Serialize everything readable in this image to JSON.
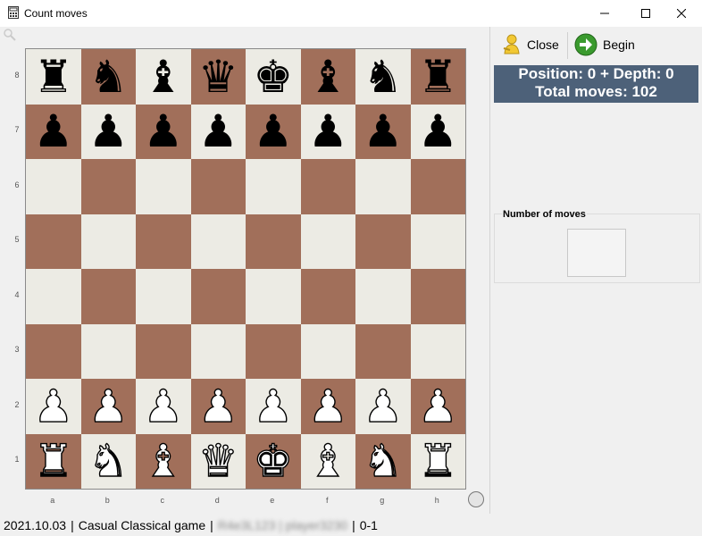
{
  "window": {
    "title": "Count moves",
    "icon": "calculator-icon",
    "controls": [
      "minimize-icon",
      "maximize-icon",
      "close-icon"
    ]
  },
  "toolbar": {
    "close_label": "Close",
    "close_icon": "person-icon",
    "begin_label": "Begin",
    "begin_icon": "arrow-right-icon"
  },
  "info": {
    "line1": "Position: 0 + Depth: 0",
    "line2": "Total moves: 102"
  },
  "moves_group": {
    "label": "Number of moves",
    "value": ""
  },
  "board": {
    "ranks": [
      "8",
      "7",
      "6",
      "5",
      "4",
      "3",
      "2",
      "1"
    ],
    "files": [
      "a",
      "b",
      "c",
      "d",
      "e",
      "f",
      "g",
      "h"
    ],
    "rows": [
      [
        "♜",
        "♞",
        "♝",
        "♛",
        "♚",
        "♝",
        "♞",
        "♜"
      ],
      [
        "♟",
        "♟",
        "♟",
        "♟",
        "♟",
        "♟",
        "♟",
        "♟"
      ],
      [
        "",
        "",
        "",
        "",
        "",
        "",
        "",
        ""
      ],
      [
        "",
        "",
        "",
        "",
        "",
        "",
        "",
        ""
      ],
      [
        "",
        "",
        "",
        "",
        "",
        "",
        "",
        ""
      ],
      [
        "",
        "",
        "",
        "",
        "",
        "",
        "",
        ""
      ],
      [
        "♟",
        "♟",
        "♟",
        "♟",
        "♟",
        "♟",
        "♟",
        "♟"
      ],
      [
        "♜",
        "♞",
        "♝",
        "♛",
        "♚",
        "♝",
        "♞",
        "♜"
      ]
    ],
    "colors": [
      "black",
      "black",
      "",
      "",
      "",
      "",
      "white",
      "white"
    ],
    "light_color": "#ecebe4",
    "dark_color": "#a16f5a"
  },
  "status": {
    "date": "2021.10.03",
    "game_type": "Casual Classical game",
    "players": "R4e3L123 | player3230",
    "result": "0-1"
  },
  "colors": {
    "info_bg": "#4d6179",
    "board_light": "#ecebe4",
    "board_dark": "#a16f5a"
  }
}
